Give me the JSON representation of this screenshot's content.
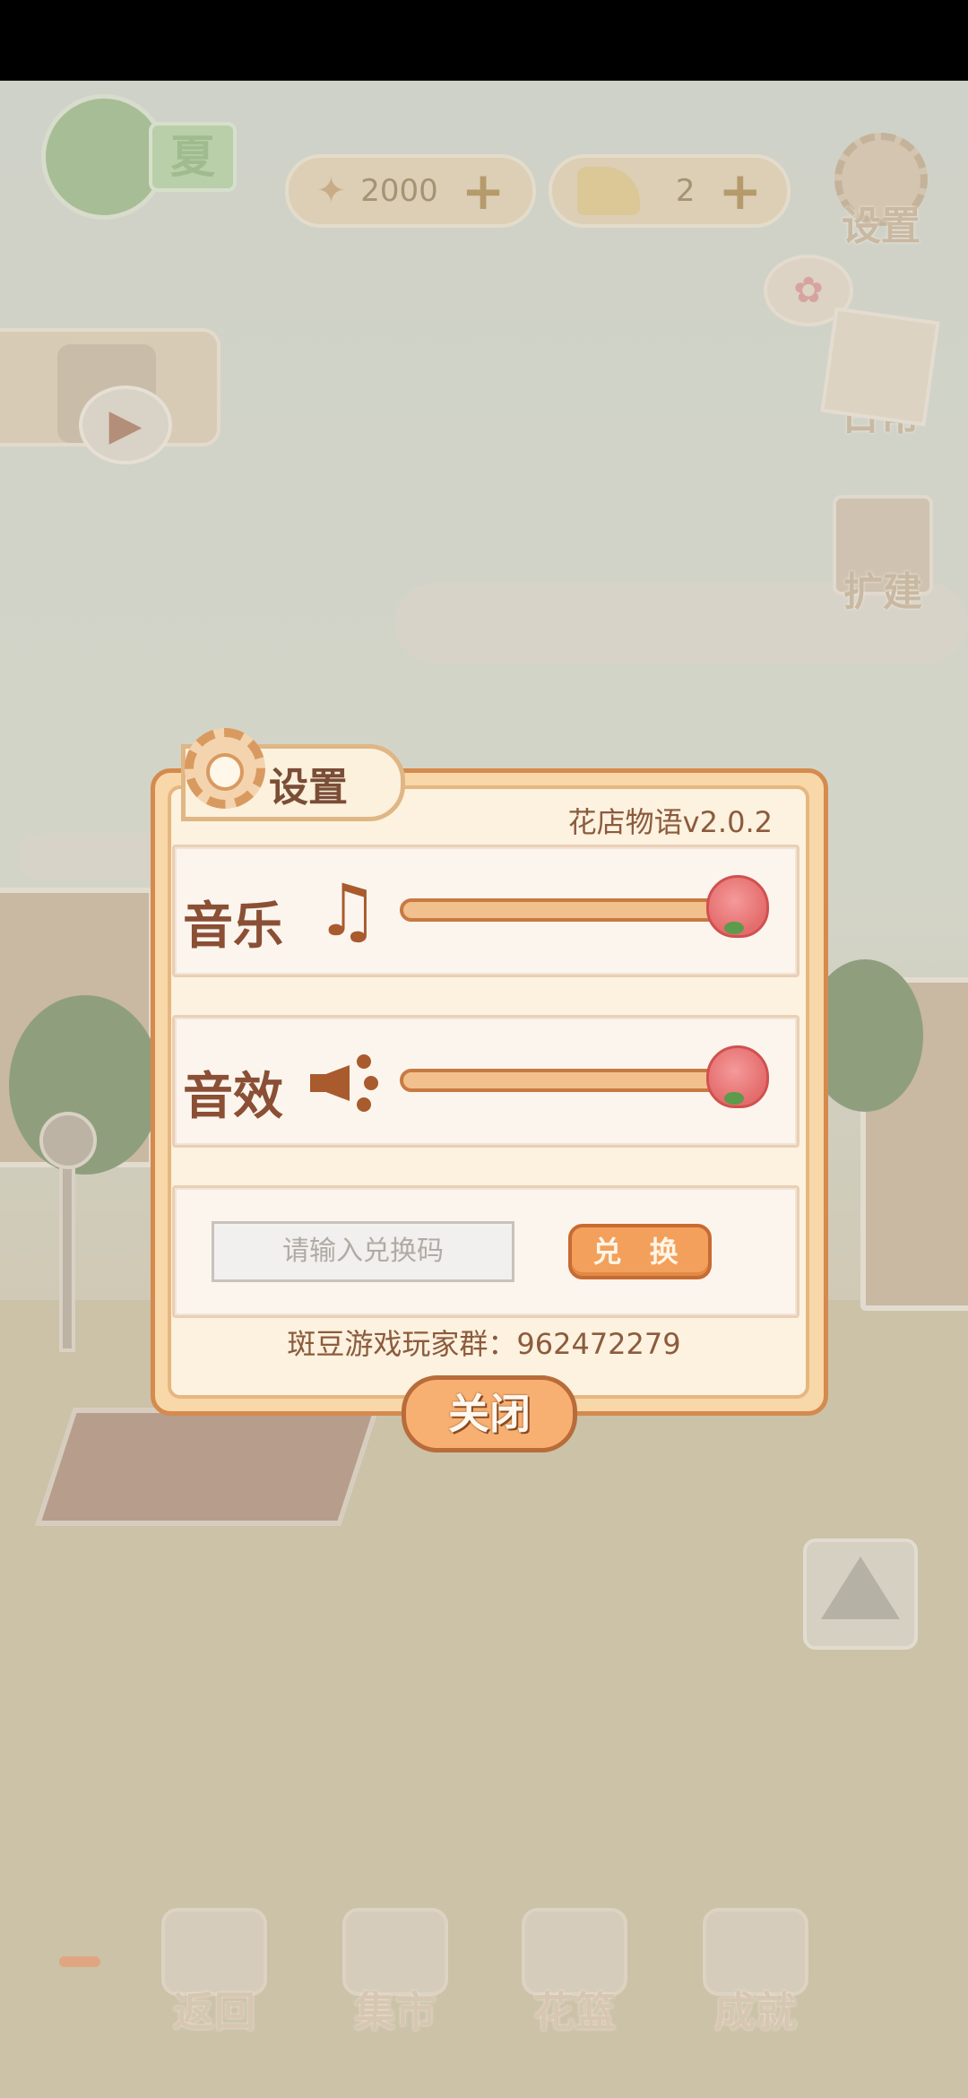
{
  "hud": {
    "season_label": "夏",
    "fish_count": "2000",
    "cheese_count": "2",
    "settings_label": "设置",
    "daily_label": "日常",
    "expand_label": "扩建"
  },
  "dialog": {
    "title": "设置",
    "version": "花店物语v2.0.2",
    "music_label": "音乐",
    "music_level": 1.0,
    "sfx_label": "音效",
    "sfx_level": 1.0,
    "code_placeholder": "请输入兑换码",
    "redeem_label": "兑 换",
    "player_group": "斑豆游戏玩家群：962472279",
    "close_label": "关闭"
  },
  "nav": {
    "items": [
      {
        "label": "返回"
      },
      {
        "label": "集市"
      },
      {
        "label": "花篮"
      },
      {
        "label": "成就"
      }
    ]
  },
  "colors": {
    "accent": "#f2a05c",
    "dialog_border": "#d58a4e",
    "text_brown": "#8a4f35",
    "knob_pink": "#e46c6c"
  }
}
